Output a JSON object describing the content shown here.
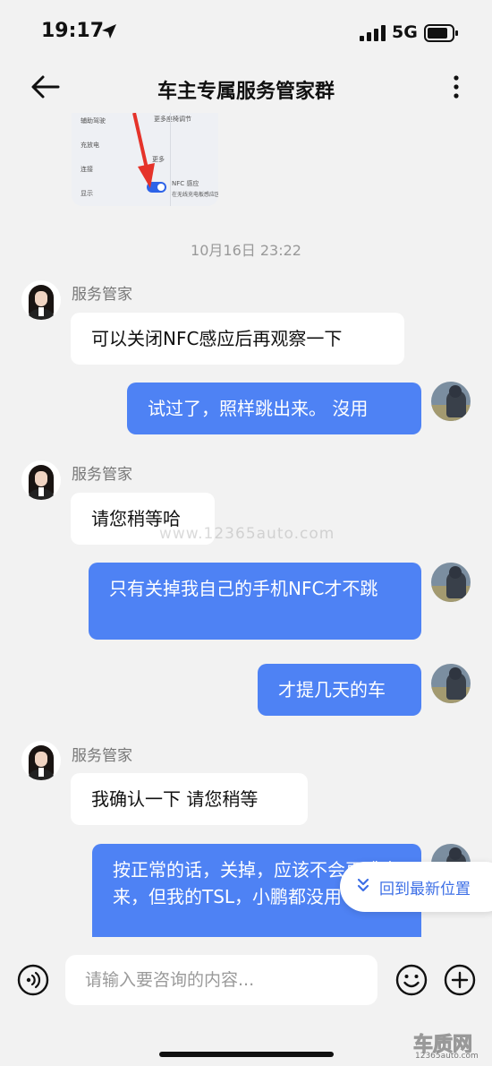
{
  "status_bar": {
    "time": "19:17",
    "network": "5G"
  },
  "nav": {
    "title": "车主专属服务管家群"
  },
  "image_thumb": {
    "rows": [
      "辅助驾驶",
      "充放电",
      "连接",
      "显示"
    ],
    "header": "更多座椅调节",
    "side": "更多",
    "nfc_label": "NFC 感应",
    "nfc_sub": "在无线充电板感应区"
  },
  "timestamp": "10月16日 23:22",
  "messages": [
    {
      "sender": "服务管家",
      "text": "可以关闭NFC感应后再观察一下"
    },
    {
      "text": "试过了，照样跳出来。 沒用"
    },
    {
      "sender": "服务管家",
      "text": "请您稍等哈"
    },
    {
      "text": "只有关掉我自己的手机NFC才不跳"
    },
    {
      "text": "才提几天的车"
    },
    {
      "sender": "服务管家",
      "text": "我确认一下  请您稍等"
    },
    {
      "text": "按正常的话，关掉，应该不会再跳出来，但我的TSL，小鹏都没用"
    }
  ],
  "watermark": "www.12365auto.com",
  "jump_button": {
    "label": "回到最新位置"
  },
  "input": {
    "placeholder": "请输入要咨询的内容..."
  },
  "brand": {
    "main": "车质网",
    "sub": "12365auto.com"
  }
}
